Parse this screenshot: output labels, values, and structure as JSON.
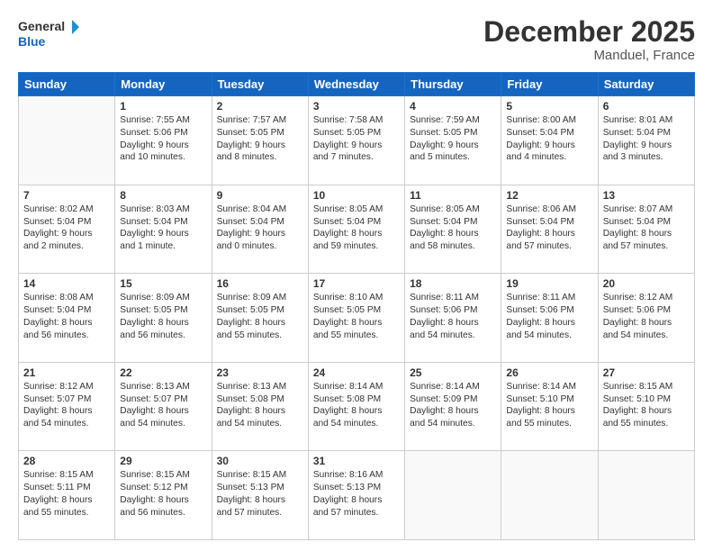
{
  "logo": {
    "line1": "General",
    "line2": "Blue"
  },
  "title": "December 2025",
  "location": "Manduel, France",
  "headers": [
    "Sunday",
    "Monday",
    "Tuesday",
    "Wednesday",
    "Thursday",
    "Friday",
    "Saturday"
  ],
  "weeks": [
    [
      {
        "day": "",
        "info": ""
      },
      {
        "day": "1",
        "info": "Sunrise: 7:55 AM\nSunset: 5:06 PM\nDaylight: 9 hours\nand 10 minutes."
      },
      {
        "day": "2",
        "info": "Sunrise: 7:57 AM\nSunset: 5:05 PM\nDaylight: 9 hours\nand 8 minutes."
      },
      {
        "day": "3",
        "info": "Sunrise: 7:58 AM\nSunset: 5:05 PM\nDaylight: 9 hours\nand 7 minutes."
      },
      {
        "day": "4",
        "info": "Sunrise: 7:59 AM\nSunset: 5:05 PM\nDaylight: 9 hours\nand 5 minutes."
      },
      {
        "day": "5",
        "info": "Sunrise: 8:00 AM\nSunset: 5:04 PM\nDaylight: 9 hours\nand 4 minutes."
      },
      {
        "day": "6",
        "info": "Sunrise: 8:01 AM\nSunset: 5:04 PM\nDaylight: 9 hours\nand 3 minutes."
      }
    ],
    [
      {
        "day": "7",
        "info": "Sunrise: 8:02 AM\nSunset: 5:04 PM\nDaylight: 9 hours\nand 2 minutes."
      },
      {
        "day": "8",
        "info": "Sunrise: 8:03 AM\nSunset: 5:04 PM\nDaylight: 9 hours\nand 1 minute."
      },
      {
        "day": "9",
        "info": "Sunrise: 8:04 AM\nSunset: 5:04 PM\nDaylight: 9 hours\nand 0 minutes."
      },
      {
        "day": "10",
        "info": "Sunrise: 8:05 AM\nSunset: 5:04 PM\nDaylight: 8 hours\nand 59 minutes."
      },
      {
        "day": "11",
        "info": "Sunrise: 8:05 AM\nSunset: 5:04 PM\nDaylight: 8 hours\nand 58 minutes."
      },
      {
        "day": "12",
        "info": "Sunrise: 8:06 AM\nSunset: 5:04 PM\nDaylight: 8 hours\nand 57 minutes."
      },
      {
        "day": "13",
        "info": "Sunrise: 8:07 AM\nSunset: 5:04 PM\nDaylight: 8 hours\nand 57 minutes."
      }
    ],
    [
      {
        "day": "14",
        "info": "Sunrise: 8:08 AM\nSunset: 5:04 PM\nDaylight: 8 hours\nand 56 minutes."
      },
      {
        "day": "15",
        "info": "Sunrise: 8:09 AM\nSunset: 5:05 PM\nDaylight: 8 hours\nand 56 minutes."
      },
      {
        "day": "16",
        "info": "Sunrise: 8:09 AM\nSunset: 5:05 PM\nDaylight: 8 hours\nand 55 minutes."
      },
      {
        "day": "17",
        "info": "Sunrise: 8:10 AM\nSunset: 5:05 PM\nDaylight: 8 hours\nand 55 minutes."
      },
      {
        "day": "18",
        "info": "Sunrise: 8:11 AM\nSunset: 5:06 PM\nDaylight: 8 hours\nand 54 minutes."
      },
      {
        "day": "19",
        "info": "Sunrise: 8:11 AM\nSunset: 5:06 PM\nDaylight: 8 hours\nand 54 minutes."
      },
      {
        "day": "20",
        "info": "Sunrise: 8:12 AM\nSunset: 5:06 PM\nDaylight: 8 hours\nand 54 minutes."
      }
    ],
    [
      {
        "day": "21",
        "info": "Sunrise: 8:12 AM\nSunset: 5:07 PM\nDaylight: 8 hours\nand 54 minutes."
      },
      {
        "day": "22",
        "info": "Sunrise: 8:13 AM\nSunset: 5:07 PM\nDaylight: 8 hours\nand 54 minutes."
      },
      {
        "day": "23",
        "info": "Sunrise: 8:13 AM\nSunset: 5:08 PM\nDaylight: 8 hours\nand 54 minutes."
      },
      {
        "day": "24",
        "info": "Sunrise: 8:14 AM\nSunset: 5:08 PM\nDaylight: 8 hours\nand 54 minutes."
      },
      {
        "day": "25",
        "info": "Sunrise: 8:14 AM\nSunset: 5:09 PM\nDaylight: 8 hours\nand 54 minutes."
      },
      {
        "day": "26",
        "info": "Sunrise: 8:14 AM\nSunset: 5:10 PM\nDaylight: 8 hours\nand 55 minutes."
      },
      {
        "day": "27",
        "info": "Sunrise: 8:15 AM\nSunset: 5:10 PM\nDaylight: 8 hours\nand 55 minutes."
      }
    ],
    [
      {
        "day": "28",
        "info": "Sunrise: 8:15 AM\nSunset: 5:11 PM\nDaylight: 8 hours\nand 55 minutes."
      },
      {
        "day": "29",
        "info": "Sunrise: 8:15 AM\nSunset: 5:12 PM\nDaylight: 8 hours\nand 56 minutes."
      },
      {
        "day": "30",
        "info": "Sunrise: 8:15 AM\nSunset: 5:13 PM\nDaylight: 8 hours\nand 57 minutes."
      },
      {
        "day": "31",
        "info": "Sunrise: 8:16 AM\nSunset: 5:13 PM\nDaylight: 8 hours\nand 57 minutes."
      },
      {
        "day": "",
        "info": ""
      },
      {
        "day": "",
        "info": ""
      },
      {
        "day": "",
        "info": ""
      }
    ]
  ]
}
